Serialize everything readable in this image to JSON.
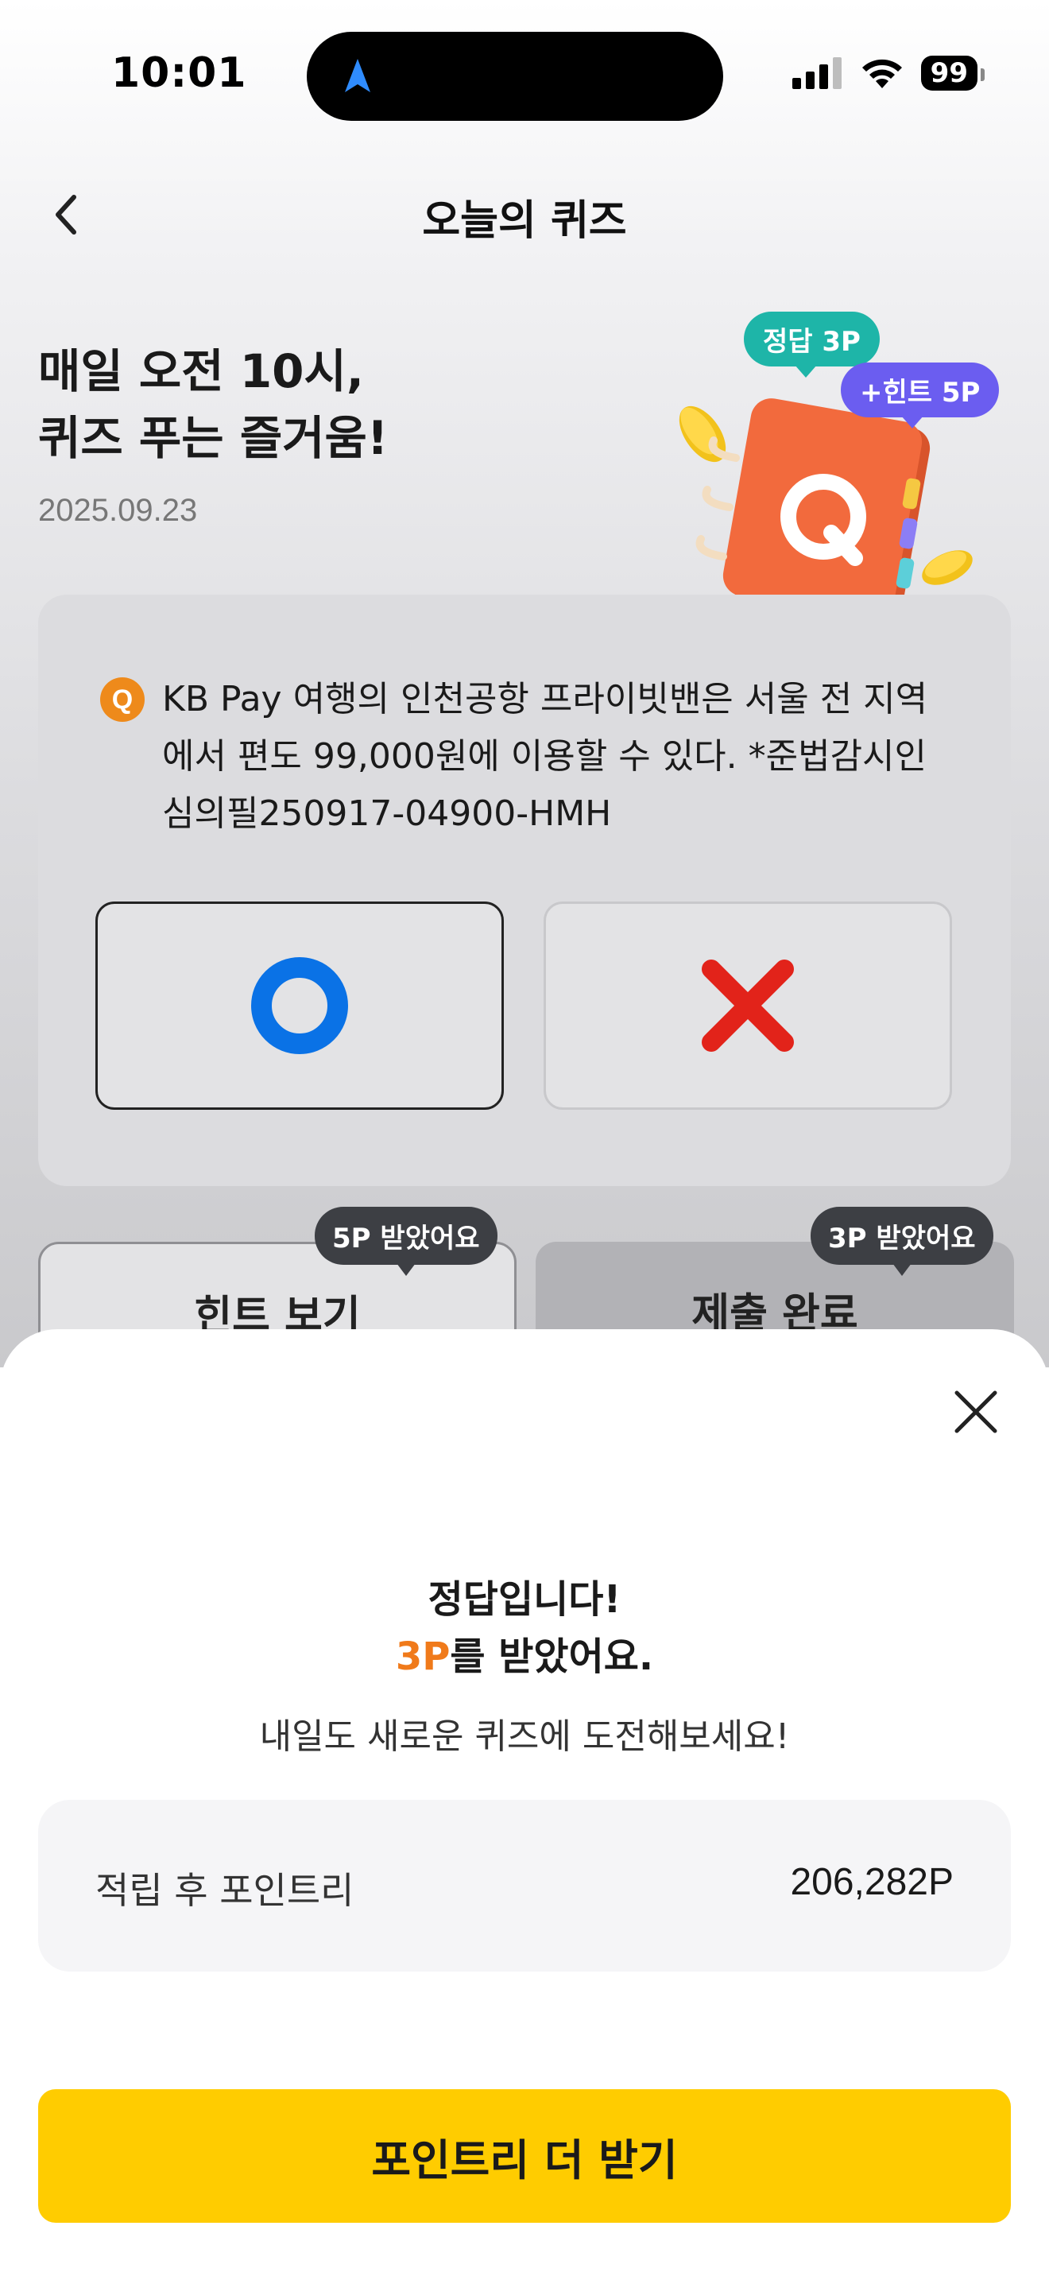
{
  "status_bar": {
    "time": "10:01",
    "battery": "99",
    "icons": [
      "location-arrow-icon",
      "signal-icon",
      "wifi-icon",
      "battery-icon"
    ]
  },
  "header": {
    "title": "오늘의 퀴즈",
    "back_icon": "chevron-left-icon"
  },
  "hero": {
    "title_line1": "매일 오전 10시,",
    "title_line2": "퀴즈 푸는 즐거움!",
    "date": "2025.09.23",
    "bubble_answer": "정답 3P",
    "bubble_hint": "+힌트 5P",
    "notebook_letter": "Q"
  },
  "quiz": {
    "badge": "Q",
    "question": "KB Pay 여행의 인천공항 프라이빗밴은 서울 전 지역에서 편도 99,000원에 이용할 수 있다. *준법감시인심의필250917-04900-HMH",
    "option_o_icon": "circle-o-icon",
    "option_x_icon": "cross-x-icon",
    "selected": "O"
  },
  "actions": {
    "hint_label": "힌트 보기",
    "hint_tag": "5P 받았어요",
    "submit_label": "제출 완료",
    "submit_tag": "3P 받았어요"
  },
  "result_sheet": {
    "title": "정답입니다!",
    "reward_amount": "3P",
    "reward_suffix": "를 받았어요.",
    "subtitle": "내일도 새로운 퀴즈에 도전해보세요!",
    "points_label": "적립 후 포인트리",
    "points_value": "206,282P",
    "cta_label": "포인트리 더 받기"
  },
  "colors": {
    "accent_yellow": "#ffcc00",
    "reward_orange": "#f07a1a",
    "o_blue": "#0a72e6",
    "x_red": "#e2231a",
    "answer_teal": "#1eb5a8",
    "hint_purple": "#6b5df0",
    "q_orange": "#ee8a1b"
  }
}
